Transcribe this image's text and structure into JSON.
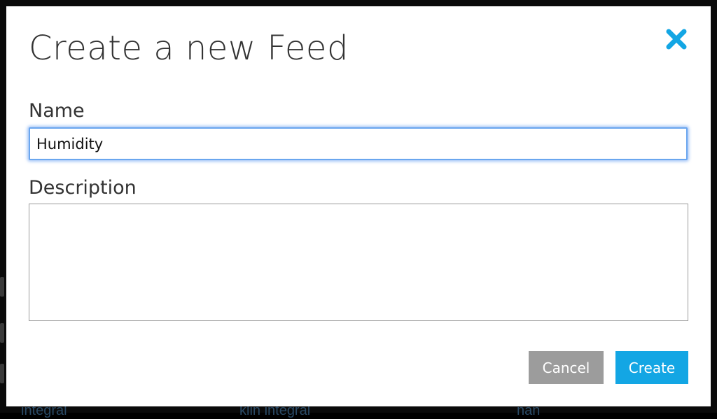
{
  "modal": {
    "title": "Create a new Feed",
    "close_icon": "close-icon",
    "accent_color": "#13a6e4",
    "fields": {
      "name_label": "Name",
      "name_value": "Humidity",
      "description_label": "Description",
      "description_value": ""
    },
    "buttons": {
      "cancel_label": "Cancel",
      "create_label": "Create",
      "cancel_color": "#9c9c9c",
      "create_color": "#13a6e4"
    }
  },
  "background": {
    "partial_text": [
      "integral",
      "klin integral",
      "nan"
    ]
  }
}
